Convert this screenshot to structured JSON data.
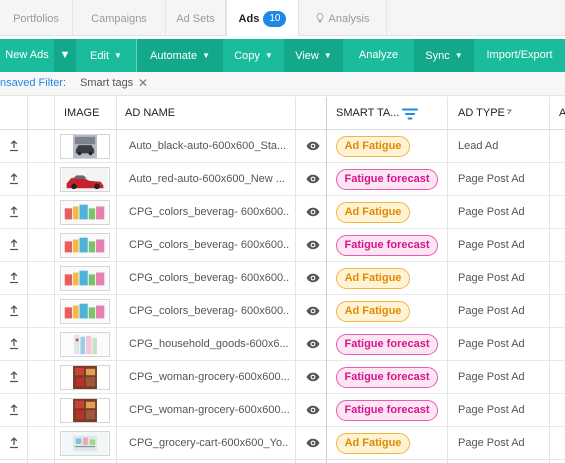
{
  "tabs": {
    "portfolios": "Portfolios",
    "campaigns": "Campaigns",
    "adsets": "Ad Sets",
    "ads": "Ads",
    "ads_count": "10",
    "analysis": "Analysis"
  },
  "toolbar": {
    "new_ads": "New Ads",
    "edit": "Edit",
    "automate": "Automate",
    "copy": "Copy",
    "view": "View",
    "analyze": "Analyze",
    "sync": "Sync",
    "import_export": "Import/Export"
  },
  "filter": {
    "label": "nsaved Filter:",
    "chip": "Smart tags",
    "remove": "✕"
  },
  "table": {
    "headers": {
      "image": "IMAGE",
      "ad_name": "AD NAME",
      "smart_tags": "SMART TA...",
      "ad_type": "AD TYPE",
      "next": "A"
    },
    "rows": [
      {
        "name": "Auto_black-auto-600x600_Sta...",
        "tag": "Ad Fatigue",
        "tag_kind": "fatigue",
        "type": "Lead Ad",
        "thumb": "car-dark"
      },
      {
        "name": "Auto_red-auto-600x600_New ...",
        "tag": "Fatigue forecast",
        "tag_kind": "forecast",
        "type": "Page Post Ad",
        "thumb": "car-red"
      },
      {
        "name": "CPG_colors_beverag- 600x600...",
        "tag": "Ad Fatigue",
        "tag_kind": "fatigue",
        "type": "Page Post Ad",
        "thumb": "cpg"
      },
      {
        "name": "CPG_colors_beverag- 600x600...",
        "tag": "Fatigue forecast",
        "tag_kind": "forecast",
        "type": "Page Post Ad",
        "thumb": "cpg"
      },
      {
        "name": "CPG_colors_beverag- 600x600...",
        "tag": "Ad Fatigue",
        "tag_kind": "fatigue",
        "type": "Page Post Ad",
        "thumb": "cpg"
      },
      {
        "name": "CPG_colors_beverag- 600x600...",
        "tag": "Ad Fatigue",
        "tag_kind": "fatigue",
        "type": "Page Post Ad",
        "thumb": "cpg"
      },
      {
        "name": "CPG_household_goods-600x6...",
        "tag": "Fatigue forecast",
        "tag_kind": "forecast",
        "type": "Page Post Ad",
        "thumb": "household"
      },
      {
        "name": "CPG_woman-grocery-600x600...",
        "tag": "Fatigue forecast",
        "tag_kind": "forecast",
        "type": "Page Post Ad",
        "thumb": "grocery"
      },
      {
        "name": "CPG_woman-grocery-600x600...",
        "tag": "Fatigue forecast",
        "tag_kind": "forecast",
        "type": "Page Post Ad",
        "thumb": "grocery"
      },
      {
        "name": "CPG_grocery-cart-600x600_Yo...",
        "tag": "Ad Fatigue",
        "tag_kind": "fatigue",
        "type": "Page Post Ad",
        "thumb": "cart"
      }
    ]
  },
  "colors": {
    "toolbar": "#1abc9c",
    "accent_blue": "#1e88e5",
    "fatigue": "#f2b640",
    "forecast": "#ec5ab5"
  },
  "icons": [
    "upload-icon",
    "eye-icon",
    "filter-icon",
    "sort-icon",
    "lightbulb-icon",
    "close-icon",
    "chevron-down-icon"
  ]
}
